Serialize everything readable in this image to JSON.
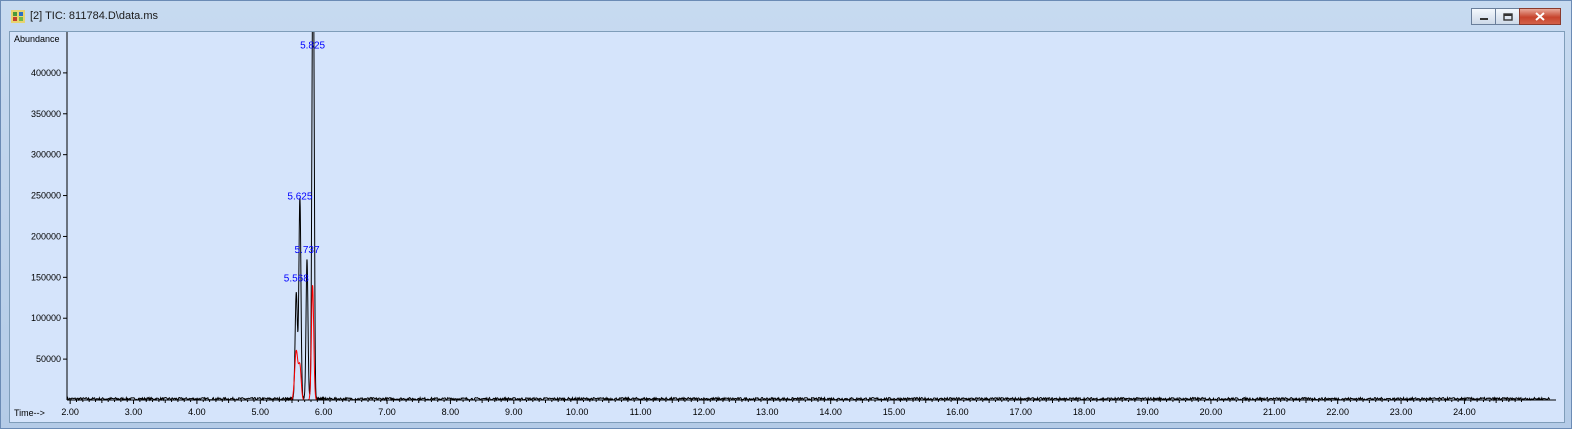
{
  "window": {
    "title": "[2] TIC: 811784.D\\data.ms",
    "icons": {
      "app": "chromatogram-app-icon",
      "minimize": "minimize-icon",
      "maximize": "maximize-icon",
      "close": "close-icon"
    }
  },
  "colors": {
    "plot_bg": "#d5e4fb",
    "axis_text": "#0000ff",
    "tic_line": "#000000",
    "secondary_line": "#ff0000",
    "peak_label": "#0000ff"
  },
  "chart_data": {
    "type": "line",
    "ylabel": "Abundance",
    "xlabel": "Time-->",
    "xlim": [
      1.95,
      25.35
    ],
    "ylim": [
      0,
      450000
    ],
    "x_ticks": [
      "2.00",
      "3.00",
      "4.00",
      "5.00",
      "6.00",
      "7.00",
      "8.00",
      "9.00",
      "10.00",
      "11.00",
      "12.00",
      "13.00",
      "14.00",
      "15.00",
      "16.00",
      "17.00",
      "18.00",
      "19.00",
      "20.00",
      "21.00",
      "22.00",
      "23.00",
      "24.00"
    ],
    "y_ticks": [
      "50000",
      "100000",
      "150000",
      "200000",
      "250000",
      "300000",
      "350000",
      "400000"
    ],
    "peak_labels": [
      {
        "label": "5.568",
        "x": 5.568,
        "y": 145000
      },
      {
        "label": "5.625",
        "x": 5.625,
        "y": 245000
      },
      {
        "label": "5.737",
        "x": 5.737,
        "y": 180000
      },
      {
        "label": "5.825",
        "x": 5.825,
        "y": 430000
      }
    ],
    "series": [
      {
        "color": "#000000",
        "peaks": [
          {
            "x": 5.568,
            "height": 130000,
            "width": 0.018
          },
          {
            "x": 5.625,
            "height": 245000,
            "width": 0.016
          },
          {
            "x": 5.737,
            "height": 170000,
            "width": 0.015
          },
          {
            "x": 5.825,
            "height": 430000,
            "width": 0.014
          },
          {
            "x": 5.845,
            "height": 300000,
            "width": 0.012
          }
        ],
        "noise": 1500
      },
      {
        "color": "#ff0000",
        "peaks": [
          {
            "x": 5.568,
            "height": 60000,
            "width": 0.025
          },
          {
            "x": 5.625,
            "height": 40000,
            "width": 0.02
          },
          {
            "x": 5.825,
            "height": 140000,
            "width": 0.018
          }
        ],
        "noise": 0
      }
    ]
  }
}
